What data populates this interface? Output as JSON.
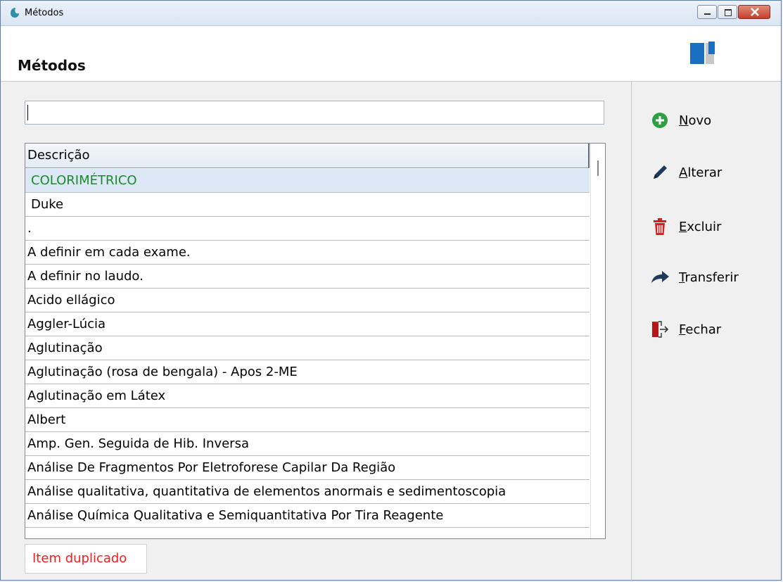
{
  "window": {
    "title": "Métodos"
  },
  "header": {
    "title": "Métodos"
  },
  "search": {
    "value": "",
    "placeholder": ""
  },
  "grid": {
    "column_header": "Descrição",
    "rows": [
      "COLORIMÉTRICO",
      "Duke",
      ".",
      "A definir em cada exame.",
      "A definir no laudo.",
      "Acido ellágico",
      "Aggler-Lúcia",
      "Aglutinação",
      "Aglutinação (rosa de bengala) - Apos 2-ME",
      "Aglutinação em Látex",
      "Albert",
      "Amp. Gen. Seguida de Hib. Inversa",
      "Análise De Fragmentos Por Eletroforese Capilar Da Região",
      "Análise qualitativa, quantitativa de elementos anormais e sedimentoscopia",
      "Análise Química Qualitativa e Semiquantitativa Por Tira Reagente"
    ],
    "selected_row_color": "#1a8a2a"
  },
  "status": {
    "text": "Item duplicado",
    "color": "#ff1a1a"
  },
  "actions": {
    "novo": {
      "mnemonic": "N",
      "rest": "ovo",
      "icon": "plus-circle-icon",
      "color": "#2ea043"
    },
    "alterar": {
      "mnemonic": "A",
      "rest": "lterar",
      "icon": "pencil-icon",
      "color": "#1f3a5a"
    },
    "excluir": {
      "mnemonic": "E",
      "rest": "xcluir",
      "icon": "trash-icon",
      "color": "#d42020"
    },
    "transferir": {
      "mnemonic": "T",
      "rest": "ransferir",
      "icon": "share-arrow-icon",
      "color": "#1f3a5a"
    },
    "fechar": {
      "mnemonic": "F",
      "rest": "echar",
      "icon": "exit-door-icon",
      "color": "#d42020"
    }
  }
}
